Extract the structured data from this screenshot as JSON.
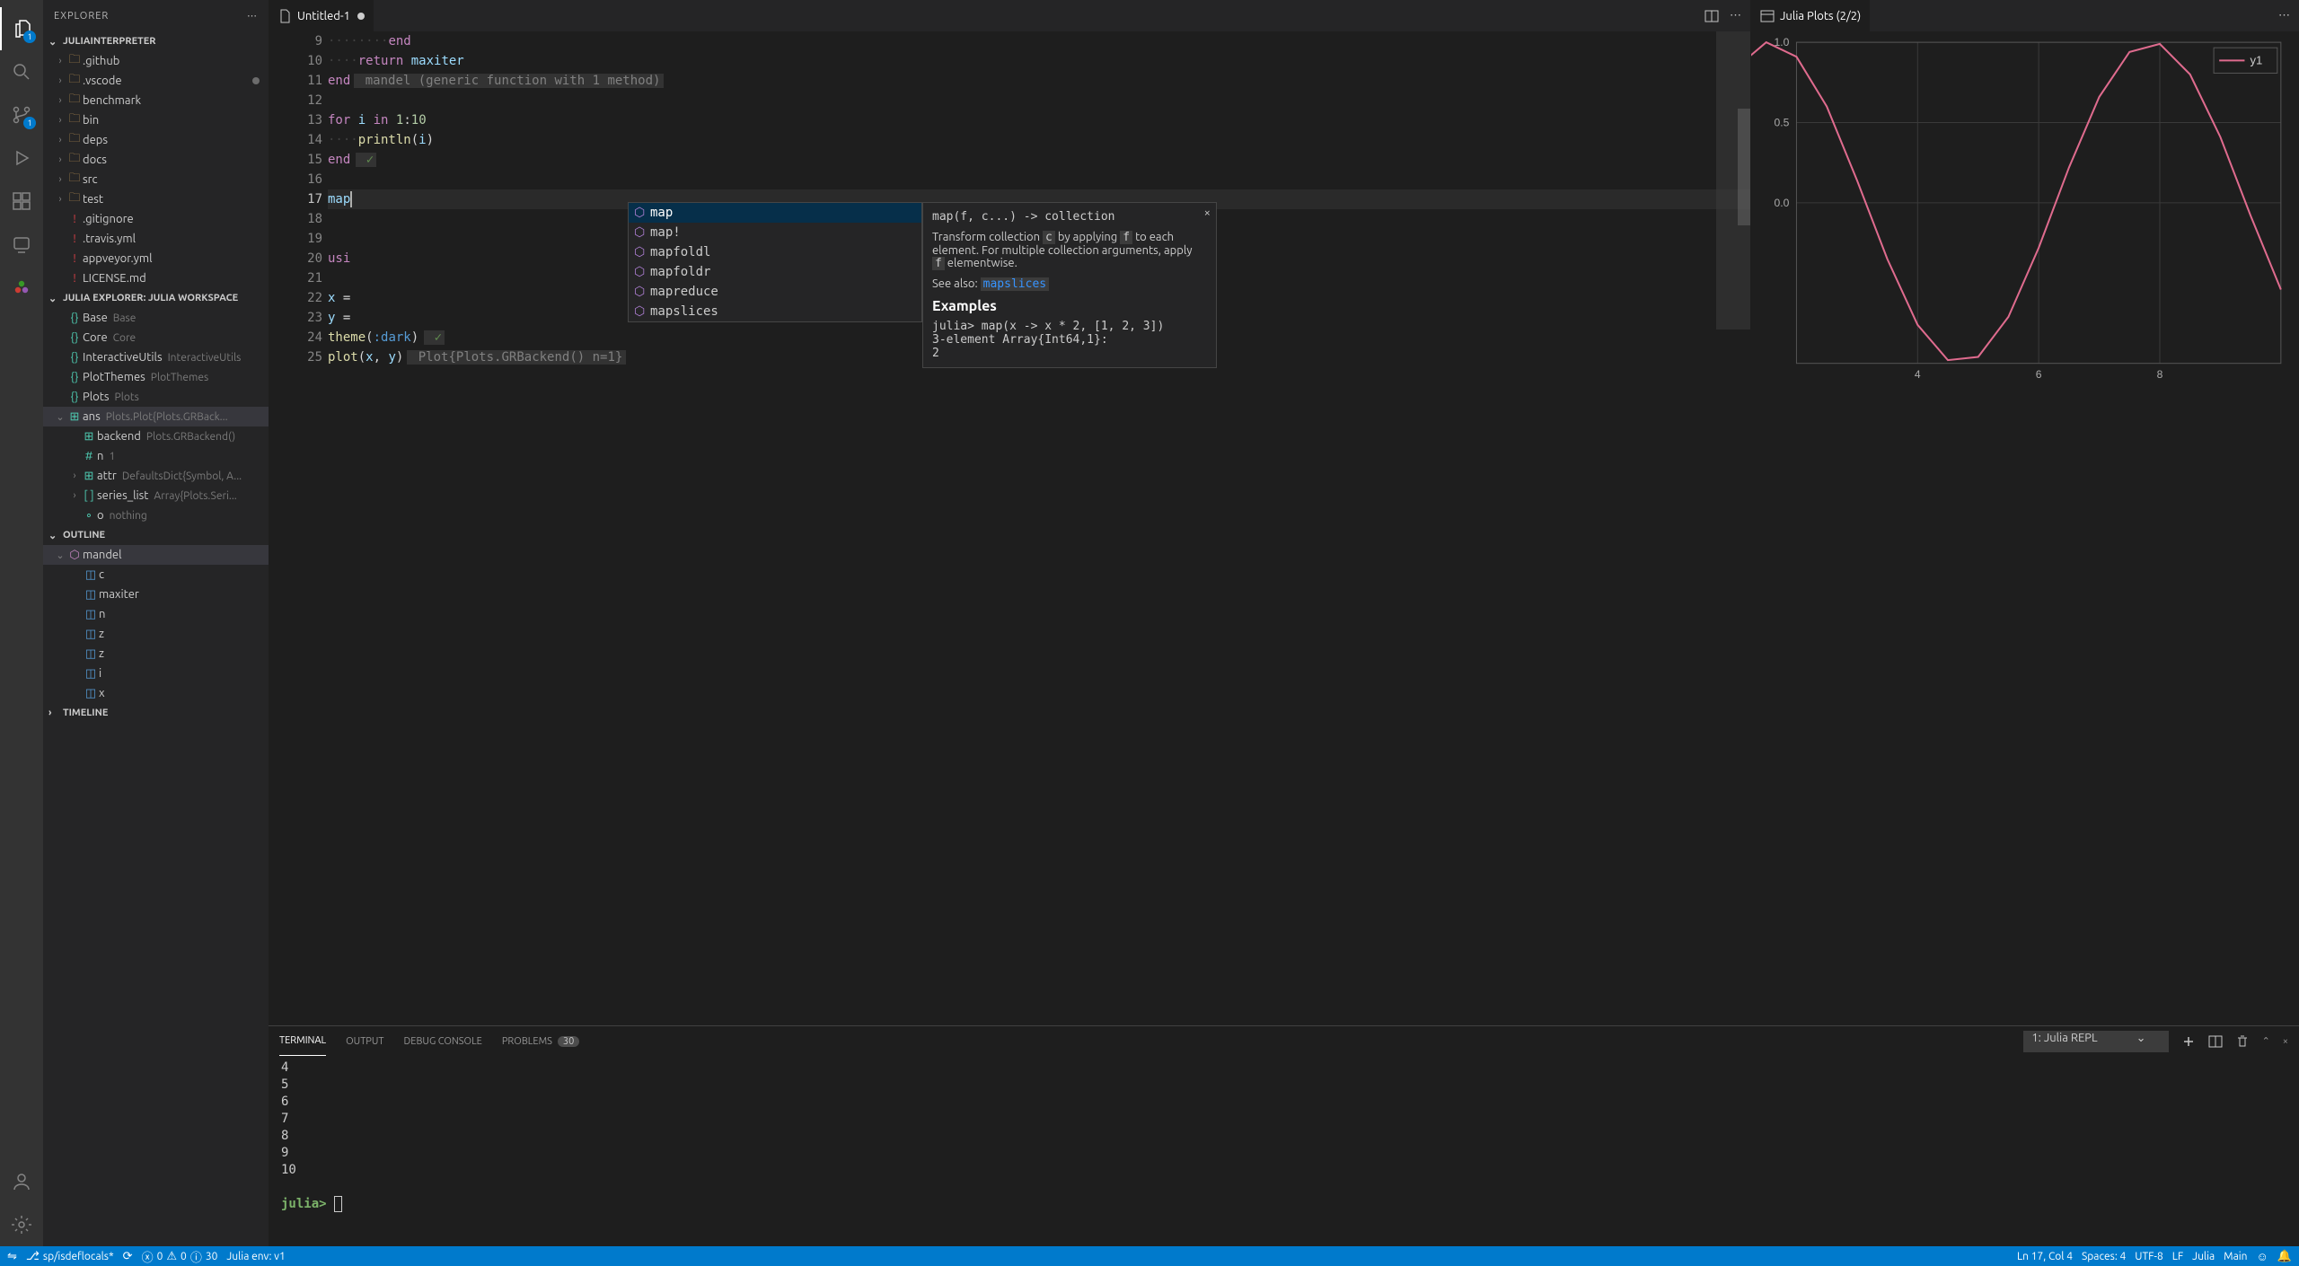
{
  "sidebar": {
    "title": "EXPLORER",
    "sections": {
      "project": "JULIAINTERPRETER",
      "workspace": "JULIA EXPLORER: JULIA WORKSPACE",
      "outline": "OUTLINE",
      "timeline": "TIMELINE"
    },
    "files": [
      {
        "name": ".github",
        "type": "folder"
      },
      {
        "name": ".vscode",
        "type": "folder",
        "modified": true
      },
      {
        "name": "benchmark",
        "type": "folder"
      },
      {
        "name": "bin",
        "type": "folder"
      },
      {
        "name": "deps",
        "type": "folder"
      },
      {
        "name": "docs",
        "type": "folder"
      },
      {
        "name": "src",
        "type": "folder"
      },
      {
        "name": "test",
        "type": "folder"
      },
      {
        "name": ".gitignore",
        "type": "file",
        "color": "red"
      },
      {
        "name": ".travis.yml",
        "type": "file",
        "color": "red"
      },
      {
        "name": "appveyor.yml",
        "type": "file",
        "color": "red"
      },
      {
        "name": "LICENSE.md",
        "type": "file",
        "color": "red"
      }
    ],
    "workspace_items": [
      {
        "name": "Base",
        "hint": "Base",
        "icon": "{}"
      },
      {
        "name": "Core",
        "hint": "Core",
        "icon": "{}"
      },
      {
        "name": "InteractiveUtils",
        "hint": "InteractiveUtils",
        "icon": "{}"
      },
      {
        "name": "PlotThemes",
        "hint": "PlotThemes",
        "icon": "{}"
      },
      {
        "name": "Plots",
        "hint": "Plots",
        "icon": "{}"
      },
      {
        "name": "ans",
        "hint": "Plots.Plot{Plots.GRBack...",
        "icon": "⊞",
        "selected": true,
        "expanded": true,
        "children": [
          {
            "name": "backend",
            "hint": "Plots.GRBackend()",
            "icon": "⊞"
          },
          {
            "name": "n",
            "hint": "1",
            "icon": "#"
          },
          {
            "name": "attr",
            "hint": "DefaultsDict{Symbol, A...",
            "icon": "⊞",
            "chev": true
          },
          {
            "name": "series_list",
            "hint": "Array{Plots.Seri...",
            "icon": "[ ]",
            "chev": true
          },
          {
            "name": "o",
            "hint": "nothing",
            "icon": "∘"
          }
        ]
      }
    ],
    "outline": {
      "root": "mandel",
      "items": [
        {
          "name": "c",
          "icon": "◫"
        },
        {
          "name": "maxiter",
          "icon": "◫"
        },
        {
          "name": "n",
          "icon": "◫"
        },
        {
          "name": "z",
          "icon": "◫"
        },
        {
          "name": "z",
          "icon": "◫"
        },
        {
          "name": "i",
          "icon": "◫"
        },
        {
          "name": "x",
          "icon": "◫"
        }
      ]
    }
  },
  "tabs": {
    "editor": "Untitled-1",
    "plot": "Julia Plots (2/2)"
  },
  "code": {
    "lines": [
      {
        "n": 9,
        "seg": [
          [
            "indent",
            "········"
          ],
          [
            "kw",
            "end"
          ]
        ]
      },
      {
        "n": 10,
        "seg": [
          [
            "indent",
            "····"
          ],
          [
            "kw",
            "return"
          ],
          [
            "op",
            " "
          ],
          [
            "var",
            "maxiter"
          ]
        ]
      },
      {
        "n": 11,
        "seg": [
          [
            "kw",
            "end"
          ],
          [
            "ghost",
            " mandel (generic function with 1 method)"
          ]
        ]
      },
      {
        "n": 12,
        "seg": []
      },
      {
        "n": 13,
        "seg": [
          [
            "kw",
            "for"
          ],
          [
            "op",
            " "
          ],
          [
            "var",
            "i"
          ],
          [
            "op",
            " "
          ],
          [
            "kw",
            "in"
          ],
          [
            "op",
            " "
          ],
          [
            "num",
            "1"
          ],
          [
            "op",
            ":"
          ],
          [
            "num",
            "10"
          ]
        ]
      },
      {
        "n": 14,
        "seg": [
          [
            "indent",
            "····"
          ],
          [
            "fn",
            "println"
          ],
          [
            "op",
            "("
          ],
          [
            "var",
            "i"
          ],
          [
            "op",
            ")"
          ]
        ]
      },
      {
        "n": 15,
        "seg": [
          [
            "kw",
            "end"
          ],
          [
            "check",
            " ✓"
          ]
        ]
      },
      {
        "n": 16,
        "seg": []
      },
      {
        "n": 17,
        "seg": [
          [
            "var",
            "map"
          ],
          [
            "cursor",
            ""
          ]
        ],
        "current": true
      },
      {
        "n": 18,
        "seg": []
      },
      {
        "n": 19,
        "seg": []
      },
      {
        "n": 20,
        "seg": [
          [
            "kw",
            "usi"
          ]
        ]
      },
      {
        "n": 21,
        "seg": []
      },
      {
        "n": 22,
        "seg": [
          [
            "var",
            "x"
          ],
          [
            "op",
            " ="
          ]
        ]
      },
      {
        "n": 23,
        "seg": [
          [
            "var",
            "y"
          ],
          [
            "op",
            " ="
          ]
        ]
      },
      {
        "n": 24,
        "seg": [
          [
            "fn",
            "theme"
          ],
          [
            "op",
            "("
          ],
          [
            "sym",
            ":dark"
          ],
          [
            "op",
            ")"
          ],
          [
            "check",
            " ✓"
          ]
        ]
      },
      {
        "n": 25,
        "seg": [
          [
            "fn",
            "plot"
          ],
          [
            "op",
            "("
          ],
          [
            "var",
            "x"
          ],
          [
            "op",
            ", "
          ],
          [
            "var",
            "y"
          ],
          [
            "op",
            ")"
          ],
          [
            "ghost",
            " Plot{Plots.GRBackend() n=1}"
          ]
        ]
      }
    ]
  },
  "suggest": {
    "items": [
      "map",
      "map!",
      "mapfoldl",
      "mapfoldr",
      "mapreduce",
      "mapslices"
    ],
    "selected": 0
  },
  "doc": {
    "sig": "map(f, c...) -> collection",
    "body1": "Transform collection ",
    "code1": "c",
    "body2": " by applying ",
    "code2": "f",
    "body3": " to each element. For multiple collection arguments, apply ",
    "code3": "f",
    "body4": " elementwise.",
    "see": "See also: ",
    "seelink": "mapslices",
    "exhead": "Examples",
    "ex1": "julia> map(x -> x * 2, [1, 2, 3])",
    "ex2": "3-element Array{Int64,1}:",
    "ex3": " 2"
  },
  "chart_data": {
    "type": "line",
    "title": "",
    "legend": [
      "y1"
    ],
    "xlim": [
      2,
      10
    ],
    "ylim": [
      -1.0,
      1.0
    ],
    "x_ticks": [
      4,
      6,
      8
    ],
    "y_ticks": [
      0.0,
      0.5,
      1.0
    ],
    "x": [
      1,
      1.5,
      2,
      2.5,
      3,
      3.5,
      4,
      4.5,
      5,
      5.5,
      6,
      6.5,
      7,
      7.5,
      8,
      8.5,
      9,
      9.5,
      10
    ],
    "series": [
      {
        "name": "y1",
        "color": "#df6b8e",
        "values": [
          0.84,
          1.0,
          0.91,
          0.6,
          0.14,
          -0.35,
          -0.76,
          -0.98,
          -0.96,
          -0.71,
          -0.28,
          0.22,
          0.66,
          0.94,
          0.99,
          0.8,
          0.41,
          -0.08,
          -0.54
        ]
      }
    ]
  },
  "panel": {
    "tabs": [
      "TERMINAL",
      "OUTPUT",
      "DEBUG CONSOLE",
      "PROBLEMS"
    ],
    "problems_count": "30",
    "select": "1: Julia REPL",
    "lines": [
      "4",
      "5",
      "6",
      "7",
      "8",
      "9",
      "10"
    ],
    "prompt": "julia>"
  },
  "statusbar": {
    "branch": "sp/isdeflocals*",
    "errors": "0",
    "warnings": "0",
    "info": "30",
    "env": "Julia env: v1",
    "ln": "Ln 17, Col 4",
    "spaces": "Spaces: 4",
    "enc": "UTF-8",
    "eol": "LF",
    "lang": "Julia",
    "main": "Main"
  },
  "activity_badges": {
    "explorer": "1",
    "scm": "1"
  }
}
